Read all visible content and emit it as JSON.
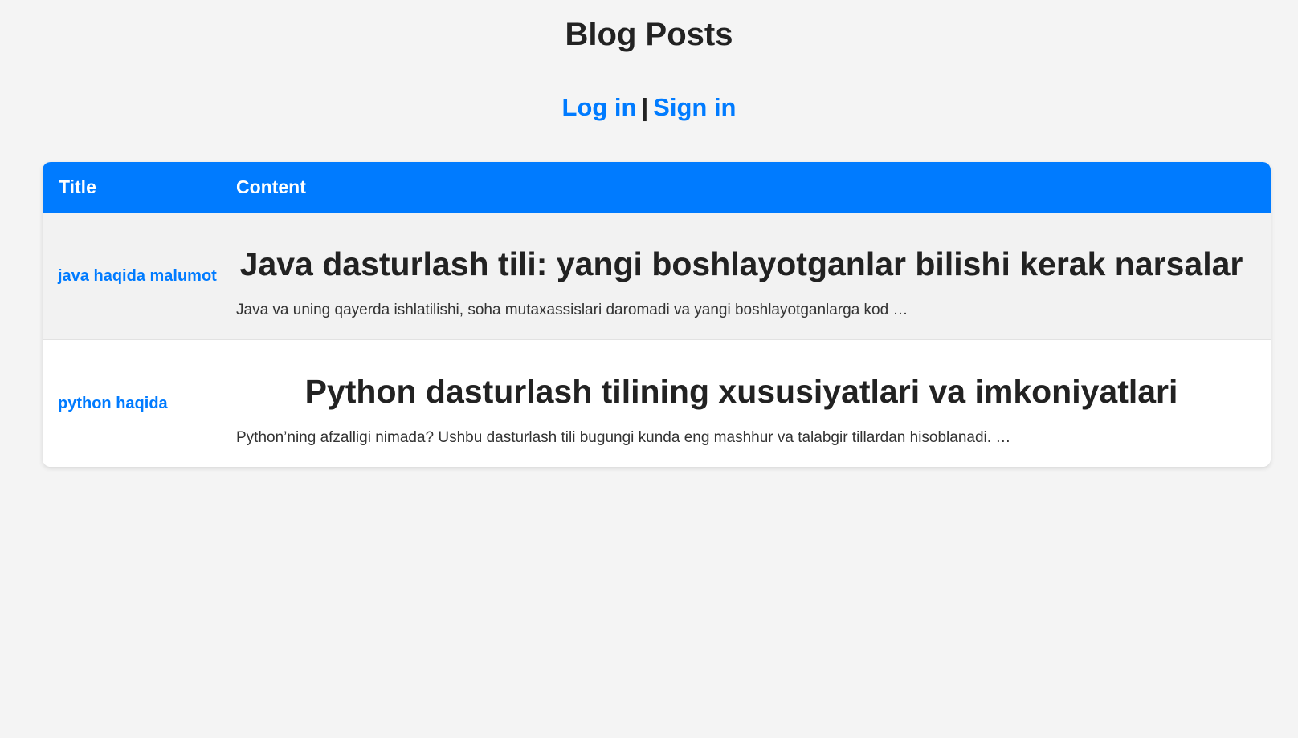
{
  "page": {
    "title": "Blog Posts"
  },
  "auth": {
    "login_label": "Log in",
    "separator": "|",
    "signin_label": "Sign in"
  },
  "table": {
    "columns": [
      "Title",
      "Content"
    ],
    "rows": [
      {
        "title": "java haqida malumot",
        "heading": "Java dasturlash tili: yangi boshlayotganlar bilishi kerak narsalar",
        "excerpt": "Java va uning qayerda ishlatilishi, soha mutaxassislari daromadi va yangi boshlayotganlarga kod …"
      },
      {
        "title": "python haqida",
        "heading": "Python dasturlash tilining xususiyatlari va imkoniyatlari",
        "excerpt": "Python’ning afzalligi nimada? Ushbu dasturlash tili bugungi kunda eng mashhur va talabgir tillardan hisoblanadi. …"
      }
    ]
  },
  "colors": {
    "accent": "#007bff",
    "background": "#f4f4f4",
    "text": "#222222"
  }
}
